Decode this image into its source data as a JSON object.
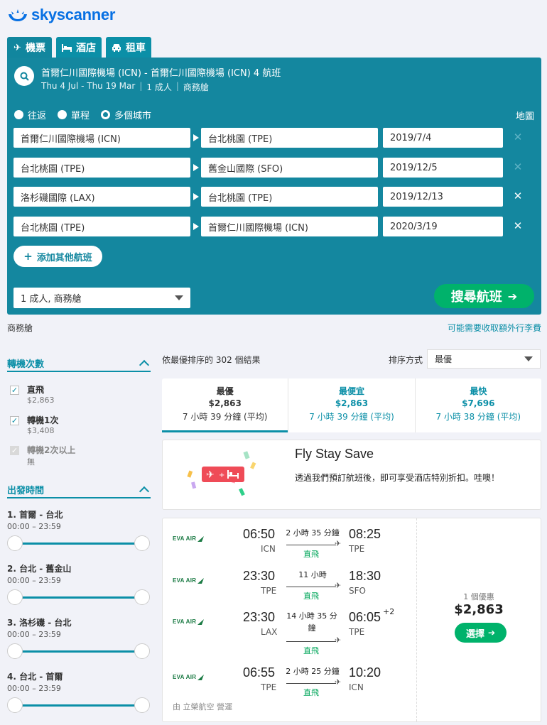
{
  "brand": {
    "name": "skyscanner",
    "color": "#0770e3"
  },
  "tabs": [
    {
      "label": "機票",
      "icon": "plane-icon"
    },
    {
      "label": "酒店",
      "icon": "bed-icon"
    },
    {
      "label": "租車",
      "icon": "car-icon"
    }
  ],
  "summary": {
    "title": "首爾仁川國際機場 (ICN) - 首爾仁川國際機場 (ICN) 4 航班",
    "dates": "Thu 4 Jul - Thu 19 Mar",
    "travellers": "1 成人",
    "cabin": "商務艙"
  },
  "trip_types": {
    "round": "往返",
    "oneway": "單程",
    "multi": "多個城市",
    "selected": "多個城市"
  },
  "map_label": "地圖",
  "legs": [
    {
      "from": "首爾仁川國際機場 (ICN)",
      "to": "台北桃園 (TPE)",
      "date": "2019/7/4",
      "removable": false
    },
    {
      "from": "台北桃園 (TPE)",
      "to": "舊金山國際 (SFO)",
      "date": "2019/12/5",
      "removable": false
    },
    {
      "from": "洛杉磯國際 (LAX)",
      "to": "台北桃園 (TPE)",
      "date": "2019/12/13",
      "removable": true
    },
    {
      "from": "台北桃園 (TPE)",
      "to": "首爾仁川國際機場 (ICN)",
      "date": "2020/3/19",
      "removable": true
    }
  ],
  "add_leg_label": "添加其他航班",
  "pax_cabin": "1 成人, 商務艙",
  "search_button": "搜尋航班",
  "cabin_note": "商務艙",
  "baggage_note": "可能需要收取額外行李費",
  "filters": {
    "stops_title": "轉機次數",
    "stops": [
      {
        "label": "直飛",
        "price": "$2,863",
        "checked": true,
        "disabled": false
      },
      {
        "label": "轉機1次",
        "price": "$3,408",
        "checked": true,
        "disabled": false
      },
      {
        "label": "轉機2次以上",
        "price": "無",
        "checked": true,
        "disabled": true
      }
    ],
    "departure_title": "出發時間",
    "departures": [
      {
        "label": "1. 首爾 - 台北",
        "range": "00:00 – 23:59"
      },
      {
        "label": "2. 台北 - 舊金山",
        "range": "00:00 – 23:59"
      },
      {
        "label": "3. 洛杉磯 - 台北",
        "range": "00:00 – 23:59"
      },
      {
        "label": "4. 台北 - 首爾",
        "range": "00:00 – 23:59"
      }
    ]
  },
  "results": {
    "count_text": "依最優排序的 302 個結果",
    "sort_label": "排序方式",
    "sort_value": "最優"
  },
  "sort_tabs": [
    {
      "name": "最優",
      "price": "$2,863",
      "duration": "7 小時 39 分鐘 (平均)"
    },
    {
      "name": "最便宜",
      "price": "$2,863",
      "duration": "7 小時 39 分鐘 (平均)"
    },
    {
      "name": "最快",
      "price": "$7,696",
      "duration": "7 小時 38 分鐘 (平均)"
    }
  ],
  "promo": {
    "title": "Fly Stay Save",
    "text": "透過我們預訂航班後，即可享受酒店特別折扣。哇噢！"
  },
  "itinerary": {
    "airline": "EVA AIR",
    "flights": [
      {
        "dep": "06:50",
        "from": "ICN",
        "duration": "2 小時 35 分鐘",
        "stops": "直飛",
        "arr": "08:25",
        "to": "TPE",
        "plus": ""
      },
      {
        "dep": "23:30",
        "from": "TPE",
        "duration": "11 小時",
        "stops": "直飛",
        "arr": "18:30",
        "to": "SFO",
        "plus": ""
      },
      {
        "dep": "23:30",
        "from": "LAX",
        "duration": "14 小時 35 分鐘",
        "stops": "直飛",
        "arr": "06:05",
        "to": "TPE",
        "plus": "+2"
      },
      {
        "dep": "06:55",
        "from": "TPE",
        "duration": "2 小時 25 分鐘",
        "stops": "直飛",
        "arr": "10:20",
        "to": "ICN",
        "plus": ""
      }
    ],
    "operated_by": "由 立榮航空 營運",
    "deals": "1 個優惠",
    "price": "$2,863",
    "select_label": "選擇"
  }
}
